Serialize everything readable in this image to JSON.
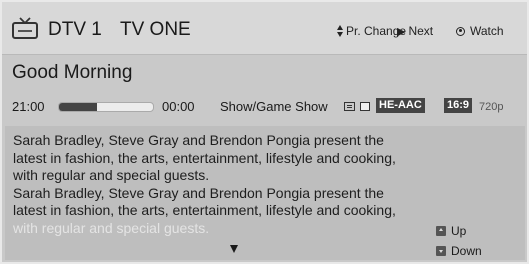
{
  "header": {
    "channel_number": "DTV 1",
    "channel_name": "TV ONE",
    "controls": [
      {
        "label": "Pr. Change",
        "icon": "up-down-arrows-icon"
      },
      {
        "label": "Next",
        "icon": "play-triangle-icon"
      },
      {
        "label": "Watch",
        "icon": "radio-dot-icon"
      }
    ]
  },
  "program": {
    "title": "Good Morning",
    "start_time": "21:00",
    "end_time": "00:00",
    "progress_fraction": 0.4,
    "genre": "Show/Game Show",
    "audio_badge": "HE-AAC",
    "aspect_badge": "16:9",
    "resolution": "720p",
    "description": "Sarah Bradley, Steve Gray and Brendon Pongia present the latest in fashion, the arts, entertainment, lifestyle and cooking, with regular and special guests.\nSarah Bradley, Steve Gray and Brendon Pongia present the latest in fashion, the arts, entertainment, lifestyle and cooking,",
    "description_faded": "with regular and special guests."
  },
  "nav": {
    "up_label": "Up",
    "down_label": "Down"
  },
  "colors": {
    "badge_bg": "#444444",
    "panel_bg": "#c9c9c9"
  }
}
